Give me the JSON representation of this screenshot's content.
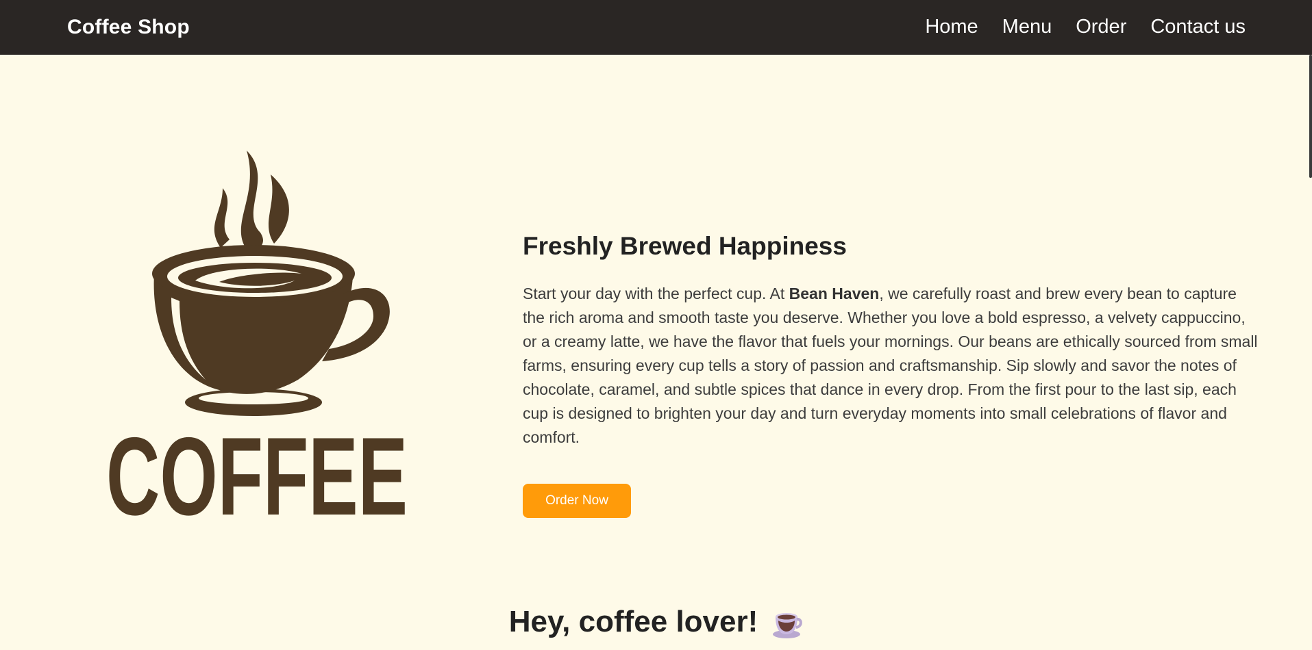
{
  "navbar": {
    "brand": "Coffee Shop",
    "links": [
      {
        "label": "Home"
      },
      {
        "label": "Menu"
      },
      {
        "label": "Order"
      },
      {
        "label": "Contact us"
      }
    ]
  },
  "hero": {
    "logo_text": "COFFEE",
    "title": "Freshly Brewed Happiness",
    "desc_before": "Start your day with the perfect cup. At ",
    "desc_bold": "Bean Haven",
    "desc_after": ", we carefully roast and brew every bean to capture the rich aroma and smooth taste you deserve. Whether you love a bold espresso, a velvety cappuccino, or a creamy latte, we have the flavor that fuels your mornings. Our beans are ethically sourced from small farms, ensuring every cup tells a story of passion and craftsmanship. Sip slowly and savor the notes of chocolate, caramel, and subtle spices that dance in every drop. From the first pour to the last sip, each cup is designed to brighten your day and turn everyday moments into small celebrations of flavor and comfort.",
    "button_label": "Order Now"
  },
  "section": {
    "greeting": "Hey, coffee lover!"
  },
  "colors": {
    "navbar_bg": "#2a2624",
    "page_bg": "#fefae8",
    "accent": "#ff9b0a",
    "logo_brown": "#4f3a23"
  },
  "icons": {
    "logo": "coffee-cup-logo-icon",
    "greeting": "coffee-cup-icon"
  }
}
